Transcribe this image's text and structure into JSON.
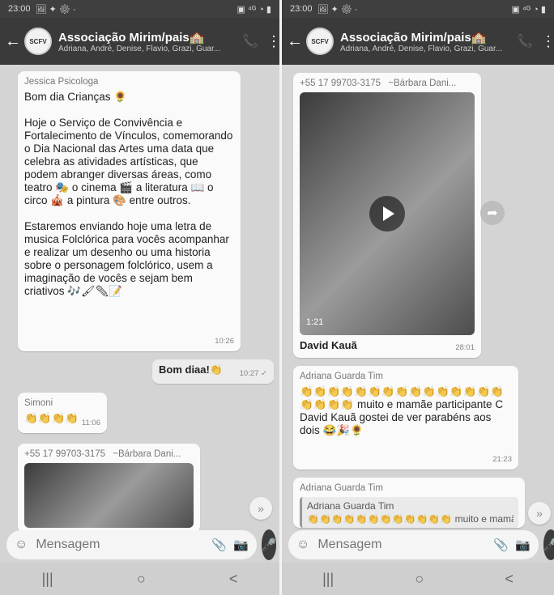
{
  "left": {
    "status": {
      "time": "23:00",
      "left_icons": "🖼 ✦ ⚙ ·",
      "right_icons": "▣ ⁴ᴳ ◔ ▮"
    },
    "header": {
      "back": "←",
      "avatar_text": "SCFV",
      "title": "Associação Mirim/pais🏫",
      "subtitle": "Adriana, André, Denise, Flavio, Grazi, Guar...",
      "call_icon": "📞",
      "menu_icon": "⋮"
    },
    "messages": [
      {
        "sender": "Jessica Psicologa",
        "text": "Bom dia Crianças 🌻\n\nHoje o Serviço de Convivência e Fortalecimento de Vínculos, comemorando o Dia Nacional das Artes uma data que celebra as atividades artísticas, que podem abranger diversas áreas, como teatro 🎭 o cinema 🎬 a literatura 📖 o circo 🎪 a pintura 🎨 entre outros.\n\nEstaremos enviando hoje uma letra de musica Folclórica para vocês acompanhar e realizar um desenho ou uma historia sobre o personagem folclórico, usem a imaginação de vocês e sejam bem criativos 🎶🖌✏📝",
        "time": "10:26"
      },
      {
        "text": "Bom diaa!👏",
        "time": "10:27 ✓"
      },
      {
        "sender": "Simoni",
        "text": "👏👏👏👏",
        "time": "11:06"
      },
      {
        "sender": "+55 17 99703-3175",
        "alias": "~Bárbara Dani..."
      }
    ],
    "input": {
      "placeholder": "Mensagem",
      "emoji_icon": "☺",
      "clip_icon": "📎",
      "camera_icon": "📷",
      "mic_icon": "🎤",
      "scroll_icon": "»"
    },
    "nav": {
      "recent": "|||",
      "home": "○",
      "back": "<"
    }
  },
  "right": {
    "status": {
      "time": "23:00",
      "left_icons": "🖼 ✦ ⚙ ·",
      "right_icons": "▣ ⁴ᴳ ◔ ▮"
    },
    "header": {
      "back": "←",
      "avatar_text": "SCFV",
      "title": "Associação Mirim/pais🏫",
      "subtitle": "Adriana, André, Denise, Flavio, Grazi, Guar...",
      "call_icon": "📞",
      "menu_icon": "⋮"
    },
    "messages": [
      {
        "sender": "+55 17 99703-3175",
        "alias": "~Bárbara Dani...",
        "duration": "1:21",
        "caption": "David Kauã",
        "time": "28:01"
      },
      {
        "sender": "Adriana Guarda Tim",
        "text": "👏👏👏👏👏👏👏👏👏👏👏👏👏👏👏👏👏👏👏 muito e mamãe participante C David Kauã gostei de ver parabéns aos dois 😂🎉🌻",
        "time": "21:23"
      },
      {
        "sender": "Adriana Guarda Tim",
        "quote_sender": "Adriana Guarda Tim",
        "quote_text": "👏👏👏👏👏👏👏👏👏👏👏👏 muito e mamãe participante C..."
      }
    ],
    "forward_icon": "➦",
    "input": {
      "placeholder": "Mensagem",
      "emoji_icon": "☺",
      "clip_icon": "📎",
      "camera_icon": "📷",
      "mic_icon": "🎤",
      "scroll_icon": "»"
    },
    "nav": {
      "recent": "|||",
      "home": "○",
      "back": "<"
    }
  }
}
